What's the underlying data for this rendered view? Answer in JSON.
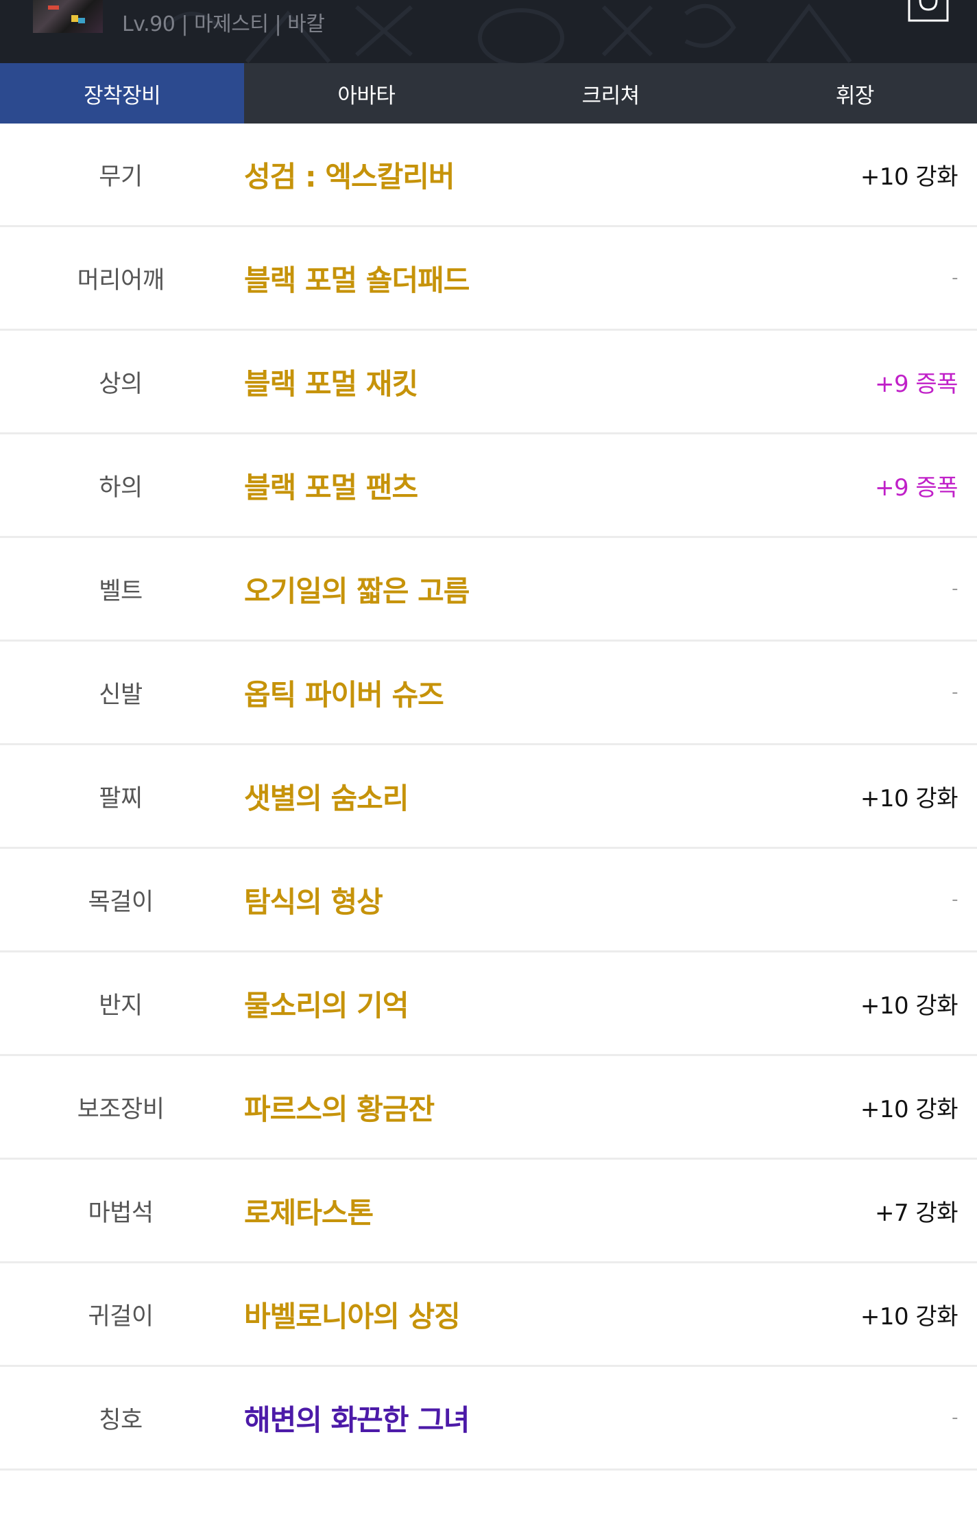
{
  "header": {
    "char_info": "Lv.90 | 마제스티 | 바칼"
  },
  "tabs": [
    {
      "label": "장착장비",
      "active": true
    },
    {
      "label": "아바타",
      "active": false
    },
    {
      "label": "크리쳐",
      "active": false
    },
    {
      "label": "휘장",
      "active": false
    }
  ],
  "colors": {
    "epic_item": "#c6930a",
    "title_item": "#4c1aa8",
    "amplify": "#c020c8",
    "reinforce": "#111111",
    "tab_active": "#2c4a8f",
    "tab_bar": "#2e333b"
  },
  "equipment": [
    {
      "slot": "무기",
      "item": "성검 : 엑스칼리버",
      "grade": "epic",
      "status": "+10 강화",
      "status_type": "reinforce"
    },
    {
      "slot": "머리어깨",
      "item": "블랙 포멀 숄더패드",
      "grade": "epic",
      "status": "-",
      "status_type": "none"
    },
    {
      "slot": "상의",
      "item": "블랙 포멀 재킷",
      "grade": "epic",
      "status": "+9 증폭",
      "status_type": "amplify"
    },
    {
      "slot": "하의",
      "item": "블랙 포멀 팬츠",
      "grade": "epic",
      "status": "+9 증폭",
      "status_type": "amplify"
    },
    {
      "slot": "벨트",
      "item": "오기일의 짧은 고름",
      "grade": "epic",
      "status": "-",
      "status_type": "none"
    },
    {
      "slot": "신발",
      "item": "옵틱 파이버 슈즈",
      "grade": "epic",
      "status": "-",
      "status_type": "none"
    },
    {
      "slot": "팔찌",
      "item": "샛별의 숨소리",
      "grade": "epic",
      "status": "+10 강화",
      "status_type": "reinforce"
    },
    {
      "slot": "목걸이",
      "item": "탐식의 형상",
      "grade": "epic",
      "status": "-",
      "status_type": "none"
    },
    {
      "slot": "반지",
      "item": "물소리의 기억",
      "grade": "epic",
      "status": "+10 강화",
      "status_type": "reinforce"
    },
    {
      "slot": "보조장비",
      "item": "파르스의 황금잔",
      "grade": "epic",
      "status": "+10 강화",
      "status_type": "reinforce"
    },
    {
      "slot": "마법석",
      "item": "로제타스톤",
      "grade": "epic",
      "status": "+7 강화",
      "status_type": "reinforce"
    },
    {
      "slot": "귀걸이",
      "item": "바벨로니아의 상징",
      "grade": "epic",
      "status": "+10 강화",
      "status_type": "reinforce"
    },
    {
      "slot": "칭호",
      "item": "해변의 화끈한 그녀",
      "grade": "title",
      "status": "-",
      "status_type": "none"
    }
  ]
}
